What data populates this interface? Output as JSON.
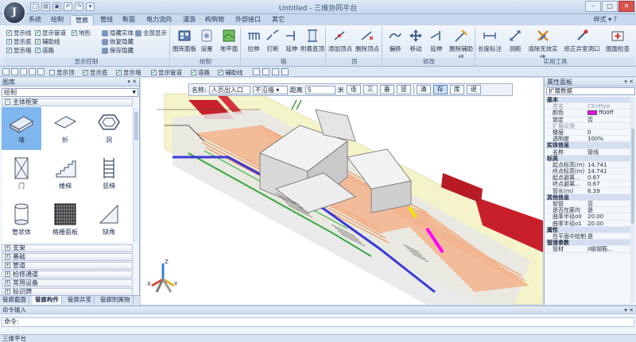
{
  "app": {
    "title": "Untitled - 三维协同平台",
    "orb_letter": "J",
    "style_menu": "样式"
  },
  "menu_tabs": [
    "系统",
    "绘制",
    "管廊",
    "管线",
    "断面",
    "电力流向",
    "漫游",
    "构筑物",
    "外部接口",
    "其它"
  ],
  "active_tab": "管廊",
  "ribbon": {
    "display_control": {
      "label": "显示控制",
      "checks": [
        {
          "text": "显示线",
          "on": true
        },
        {
          "text": "显示管道",
          "on": true
        },
        {
          "text": "地形",
          "on": true
        },
        {
          "text": "显示底",
          "on": true
        },
        {
          "text": "辅助线",
          "on": true
        },
        {
          "text": "显示墙",
          "on": true
        },
        {
          "text": "道路",
          "on": true
        }
      ],
      "hide_entity": "隐藏实体",
      "show_all": "全部显示",
      "restore_hidden": "恢复隐藏",
      "save_hidden": "保存隐藏"
    },
    "draw": {
      "label": "绘制",
      "buttons": [
        "图库面板",
        "设置",
        "地平面"
      ]
    },
    "wall": {
      "label": "墙",
      "buttons": [
        "拉伸",
        "打断",
        "延伸",
        "附着底顶"
      ]
    },
    "vertex": {
      "label": "顶",
      "buttons": [
        "添加顶点",
        "删除顶点"
      ]
    },
    "modify": {
      "label": "修改",
      "buttons": [
        "偏移",
        "移动",
        "延伸",
        "删除辅助线"
      ]
    },
    "tools": {
      "label": "实用工具",
      "buttons": [
        "长度标注",
        "测距",
        "清除无效实体",
        "修正井室洞口",
        "图面检查"
      ]
    }
  },
  "toolbar2": {
    "checks": [
      {
        "text": "显示顶",
        "on": false
      },
      {
        "text": "显示底",
        "on": true
      },
      {
        "text": "显示墙",
        "on": true
      },
      {
        "text": "显示管道",
        "on": true
      },
      {
        "text": "道路",
        "on": true
      },
      {
        "text": "辅助线",
        "on": true
      }
    ]
  },
  "left_panel": {
    "title": "图库",
    "dropdown": "绘制",
    "category_open": "主体框架",
    "items": [
      "墙",
      "折",
      "洞",
      "门",
      "楼梯",
      "竖梯",
      "管状体",
      "格栅面板",
      "缺角"
    ],
    "selected_item": "墙",
    "categories": [
      "支架",
      "基础",
      "管道",
      "检修通道",
      "常用设备",
      "标识牌"
    ],
    "bottom_tabs": [
      "管廊截面",
      "管廊构件",
      "管廊井室",
      "管廊附属物"
    ],
    "active_bottom_tab": "管廊构件"
  },
  "viewport": {
    "snap": {
      "name_label": "名称:",
      "name_value": "人员出入口",
      "wall_mode": "不沿墙",
      "distance_label": "距离",
      "distance_value": "5",
      "unit": "米",
      "buttons": [
        "连",
        "三",
        "垂",
        "竖"
      ],
      "actions": [
        "清",
        "存",
        "库",
        "退"
      ],
      "active_action": "存"
    },
    "axis_labels": {
      "x": "X",
      "y": "Y",
      "z": "Z"
    }
  },
  "right_panel": {
    "title": "属性面板",
    "dropdown": "扩展数据",
    "rows": [
      {
        "type": "cat",
        "k": "基本"
      },
      {
        "k": "类名",
        "v": "CEnPipe",
        "dim": true
      },
      {
        "k": "颜色",
        "v": "ff00ff",
        "swatch": "#ff00ff"
      },
      {
        "k": "锁定",
        "v": "否"
      },
      {
        "k": "扩展纹理",
        "v": "",
        "dim": true
      },
      {
        "k": "楼层",
        "v": "0"
      },
      {
        "k": "透明度",
        "v": "100%"
      },
      {
        "type": "cat",
        "k": "实体信息"
      },
      {
        "k": "名称",
        "v": "管线"
      },
      {
        "type": "cat",
        "k": "标高"
      },
      {
        "k": "起点标高(m)",
        "v": "14.741"
      },
      {
        "k": "终点标高(m)",
        "v": "14.741"
      },
      {
        "k": "起点避离...",
        "v": "0.67"
      },
      {
        "k": "终点避离...",
        "v": "0.67"
      },
      {
        "k": "管长(m)",
        "v": "6.39"
      },
      {
        "type": "cat",
        "k": "其他信息"
      },
      {
        "k": "软管",
        "v": "否"
      },
      {
        "k": "是否在廊内",
        "v": "是"
      },
      {
        "k": "曲率半径o0",
        "v": "20.00"
      },
      {
        "k": "曲率半径o1",
        "v": "20.00"
      },
      {
        "type": "cat",
        "k": "属性"
      },
      {
        "k": "在平面中绘制",
        "v": "是"
      },
      {
        "type": "cat",
        "k": "管道参数"
      },
      {
        "k": "管材",
        "v": "II级钢筋..."
      }
    ]
  },
  "command": {
    "title": "命令输入",
    "prompt": "命令:"
  },
  "status": {
    "text": "三维平台"
  },
  "colors": {
    "accent": "#ff00ff",
    "wall_red": "#c8202a",
    "pipe_blue": "#3a3ad8",
    "pipe_green": "#3aa845",
    "cable_orange": "#f08a4b"
  }
}
